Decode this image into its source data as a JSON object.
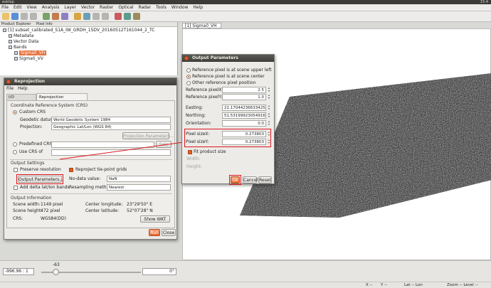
{
  "window": {
    "title": "esktop",
    "clock": "15:4"
  },
  "menu": [
    "File",
    "Edit",
    "View",
    "Analysis",
    "Layer",
    "Vector",
    "Raster",
    "Optical",
    "Radar",
    "Tools",
    "Window",
    "Help"
  ],
  "left_panel": {
    "tabs": [
      "Product Explorer",
      "Pixel Info"
    ],
    "product": "[1] subset_calibrated_S1A_IW_GRDH_1SDV_20160512T161044_2_TC",
    "nodes": [
      "Metadata",
      "Vector Data",
      "Bands"
    ],
    "bands": [
      "Sigma0_VH",
      "Sigma0_VV"
    ]
  },
  "view_tab": "[1] Sigma0_VH",
  "reprojection": {
    "title": "Reprojection",
    "menu": [
      "File",
      "Help"
    ],
    "tabs": [
      "I/O Parameters",
      "Reprojection Parameters"
    ],
    "crs_group": "Coordinate Reference System (CRS)",
    "custom_crs": "Custom CRS",
    "geodetic_label": "Geodetic datum:",
    "geodetic_value": "World Geodetic System 1984",
    "projection_label": "Projection:",
    "projection_value": "Geographic Lat/Lon (WGS 84)",
    "projection_params": "Projection Parameters...",
    "predefined_crs": "Predefined CRS",
    "select_btn": "Sele",
    "use_crs_of": "Use CRS of",
    "output_settings": "Output Settings",
    "preserve_resolution": "Preserve resolution",
    "reproject_tiepoints": "Reproject tie-point grids",
    "output_params_btn": "Output Parameters...",
    "nodata_label": "No-data value:",
    "nodata_value": "NaN",
    "add_delta": "Add delta lat/lon bands",
    "resampling_label": "Resampling method:",
    "resampling_value": "Nearest",
    "output_info": "Output Information",
    "scene_width_label": "Scene width:",
    "scene_width_value": "1149 pixel",
    "scene_height_label": "Scene height:",
    "scene_height_value": "472  pixel",
    "crs_label": "CRS:",
    "crs_value": "WGS84(DD)",
    "center_lon_label": "Center longitude:",
    "center_lon_value": "23°29'50\" E",
    "center_lat_label": "Center latitude:",
    "center_lat_value": "52°07'28\" N",
    "show_wkt": "Show WKT",
    "run": "Run",
    "close": "Close"
  },
  "output_params": {
    "title": "Output Parameters",
    "opt1": "Reference pixel is at scene upper left",
    "opt2": "Reference pixel is at scene center",
    "opt3": "Other reference pixel position",
    "refx_label": "Reference pixelX:",
    "refx_value": "2.5",
    "refy_label": "Reference pixelY:",
    "refy_value": "1.0",
    "easting_label": "Easting:",
    "easting_value": "21.17044236633425",
    "northing_label": "Northing:",
    "northing_value": "51.53199923054916",
    "orientation_label": "Orientation:",
    "orientation_value": "0.0",
    "sizex_label": "Pixel sizeX:",
    "sizex_value": "0.273803",
    "sizey_label": "Pixel sizeY:",
    "sizey_value": "0.273803",
    "fit_label": "Fit product size",
    "width_label": "Width:",
    "height_label": "Height:",
    "ok": "Ok",
    "cancel": "Cancel",
    "reset": "Reset"
  },
  "nav": {
    "rotation": "-996.96 : 1",
    "slider_value": "-63",
    "angle": "0°"
  },
  "status": {
    "x": "X --",
    "y": "Y --",
    "lat": "Lat -- Lon",
    "zoom": "Zoom -- Level --"
  },
  "colors": {
    "accent": "#e8703b",
    "highlight": "#e0161c"
  }
}
